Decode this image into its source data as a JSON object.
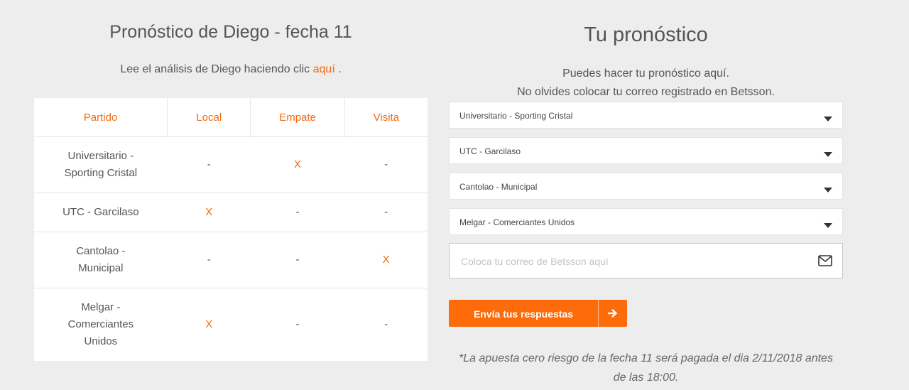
{
  "left": {
    "title": "Pronóstico de Diego - fecha 11",
    "subtitle_prefix": "Lee el análisis de Diego haciendo clic",
    "subtitle_link": "aquí",
    "subtitle_suffix": " .",
    "table": {
      "headers": [
        "Partido",
        "Local",
        "Empate",
        "Visita"
      ],
      "rows": [
        {
          "match_lines": [
            "Universitario -",
            "Sporting Cristal"
          ],
          "local": "-",
          "empate": "X",
          "visita": "-"
        },
        {
          "match_lines": [
            "UTC - Garcilaso"
          ],
          "local": "X",
          "empate": "-",
          "visita": "-"
        },
        {
          "match_lines": [
            "Cantolao -",
            "Municipal"
          ],
          "local": "-",
          "empate": "-",
          "visita": "X"
        },
        {
          "match_lines": [
            "Melgar -",
            "Comerciantes",
            "Unidos"
          ],
          "local": "X",
          "empate": "-",
          "visita": "-"
        }
      ]
    }
  },
  "right": {
    "title": "Tu pronóstico",
    "subtitle_line1": "Puedes hacer tu pronóstico aquí.",
    "subtitle_line2": "No olvides colocar tu correo registrado en Betsson.",
    "selects": [
      "Universitario - Sporting Cristal",
      "UTC - Garcilaso",
      "Cantolao - Municipal",
      "Melgar - Comerciantes Unidos"
    ],
    "email_placeholder": "Coloca tu correo de Betsson aquí",
    "email_value": "",
    "submit_label": "Envía tus respuestas",
    "note_line1": "*La apuesta cero riesgo de la fecha 11 será pagada el dia 2/11/2018 antes",
    "note_line2": "de las 18:00."
  },
  "colors": {
    "accent": "#f26a10",
    "button": "#fd6b0a",
    "background": "#ededed"
  },
  "icons": {
    "email": "envelope-icon",
    "submit": "arrow-right-icon",
    "select": "caret-down-icon"
  }
}
